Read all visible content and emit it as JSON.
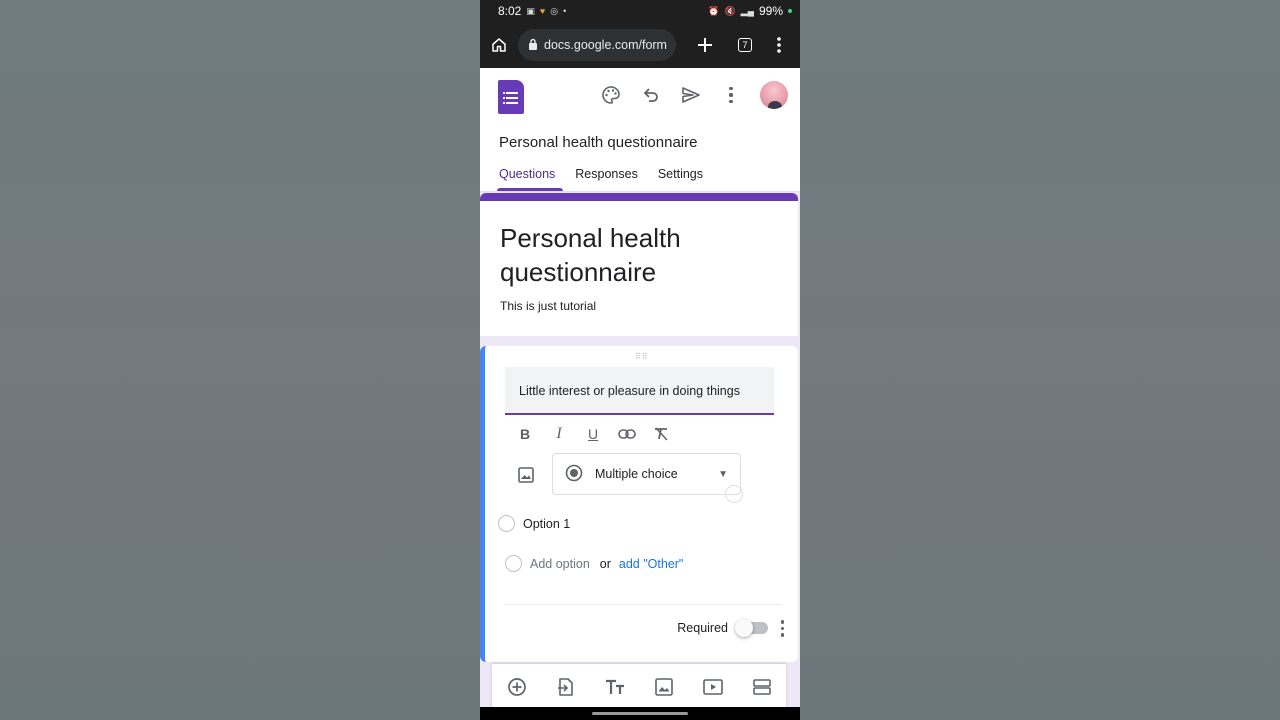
{
  "status_bar": {
    "time": "8:02",
    "battery": "99%"
  },
  "browser": {
    "url": "docs.google.com/form",
    "tab_count": "7"
  },
  "header": {
    "form_name": "Personal health questionnaire",
    "tabs": [
      {
        "label": "Questions",
        "active": true
      },
      {
        "label": "Responses",
        "active": false
      },
      {
        "label": "Settings",
        "active": false
      }
    ]
  },
  "title_card": {
    "title": "Personal health questionnaire",
    "description": "This is just tutorial"
  },
  "question": {
    "text": "Little interest or pleasure in doing things",
    "type": "Multiple choice",
    "option_1": "Option 1",
    "add_option": "Add option",
    "or": "or",
    "add_other": "add \"Other\"",
    "required_label": "Required",
    "required": false
  },
  "colors": {
    "accent": "#673ab7",
    "focus": "#4285f4",
    "link": "#1a73e8"
  },
  "icons": [
    "home-icon",
    "lock-icon",
    "plus-icon",
    "kebab-icon",
    "palette-icon",
    "undo-icon",
    "send-icon",
    "bold-icon",
    "italic-icon",
    "underline-icon",
    "link-icon",
    "clear-format-icon",
    "image-icon",
    "radio-icon",
    "add-question-icon",
    "import-icon",
    "title-icon",
    "add-image-icon",
    "video-icon",
    "section-icon"
  ]
}
